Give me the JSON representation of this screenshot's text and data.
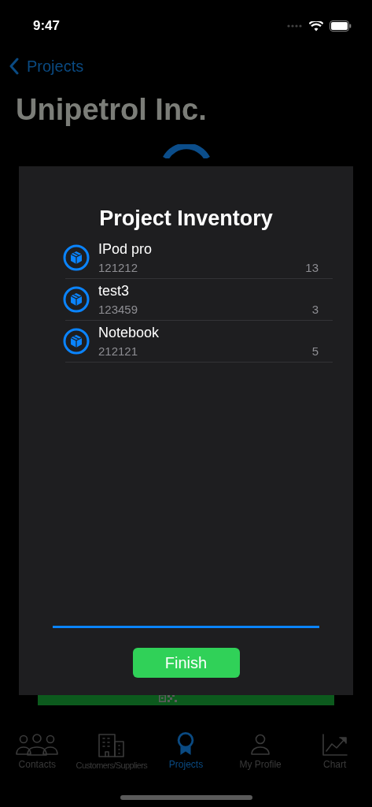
{
  "status_bar": {
    "time": "9:47"
  },
  "nav": {
    "back": "Projects",
    "title": "Unipetrol Inc."
  },
  "modal": {
    "title": "Project Inventory",
    "items": [
      {
        "name": "IPod pro",
        "code": "121212",
        "count": "13"
      },
      {
        "name": "test3",
        "code": "123459",
        "count": "3"
      },
      {
        "name": "Notebook",
        "code": "212121",
        "count": "5"
      }
    ],
    "progress": {
      "level": 1
    },
    "finish": "Finish"
  },
  "tabs": [
    {
      "label": "Contacts",
      "kind": "people",
      "selected": false
    },
    {
      "label": "Customers/Suppliers",
      "kind": "building",
      "selected": false
    },
    {
      "label": "Projects",
      "kind": "award",
      "selected": true
    },
    {
      "label": "My Profile",
      "kind": "person",
      "selected": false
    },
    {
      "label": "Chart",
      "kind": "chart",
      "selected": false
    }
  ]
}
